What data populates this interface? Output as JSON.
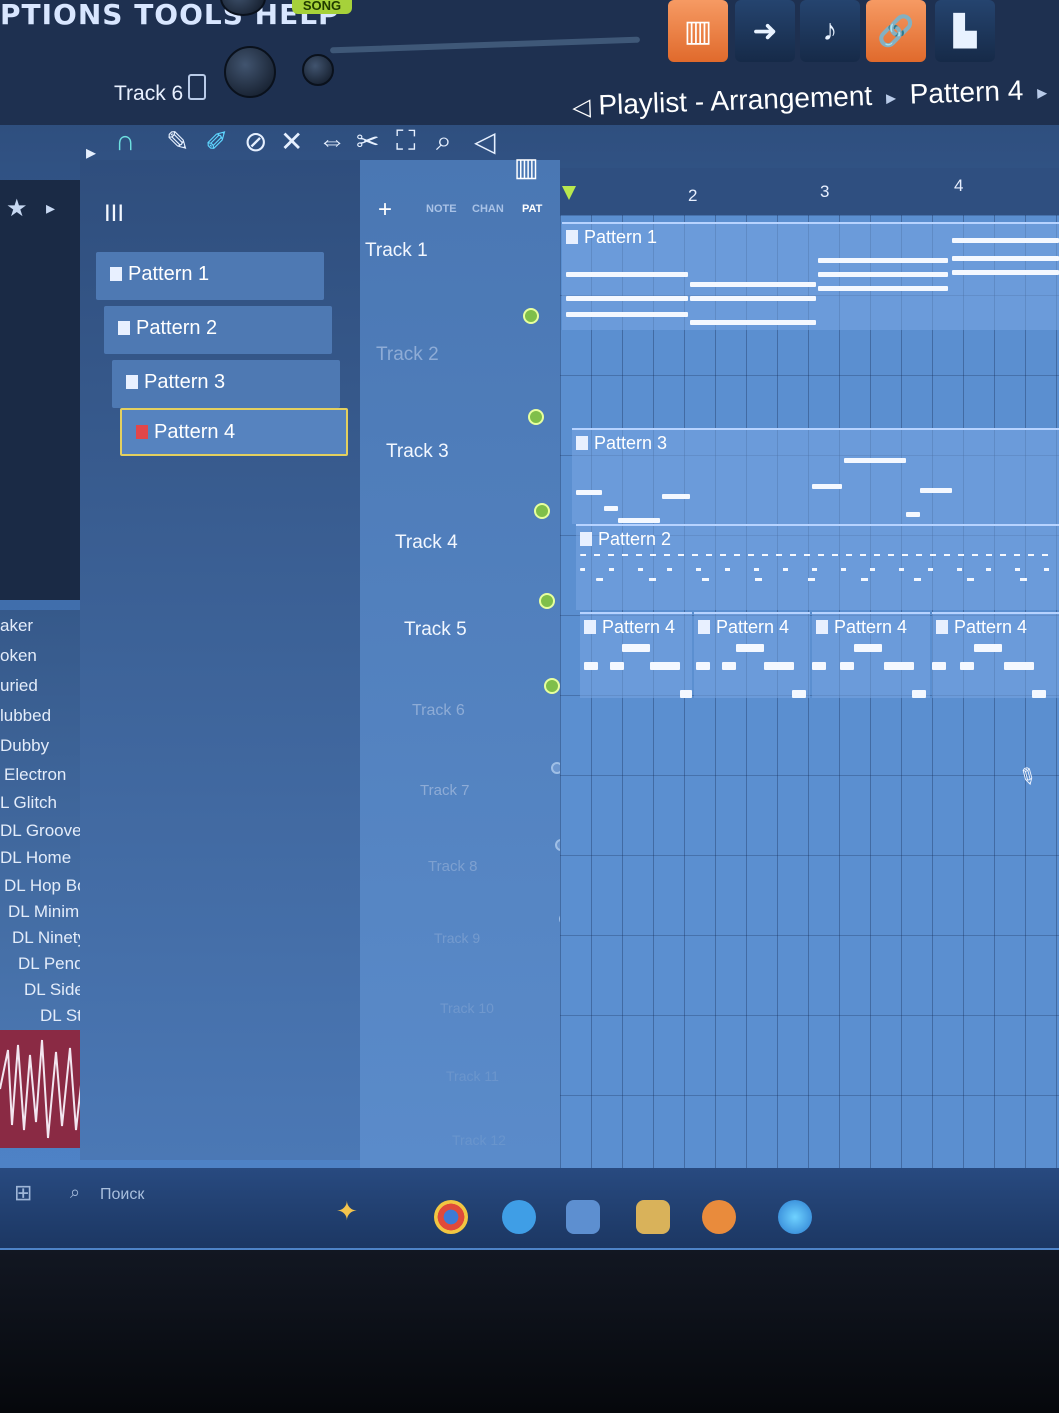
{
  "menu": {
    "options_tools_help": "PTIONS TOOLS HELP",
    "song_mode": "SONG"
  },
  "channel": {
    "track_label": "Track 6"
  },
  "window": {
    "title": "Playlist - Arrangement",
    "current_pattern": "Pattern 4"
  },
  "toolbar_icons": [
    "play-arrow-icon",
    "magnet-icon",
    "pencil-icon",
    "paint-icon",
    "delete-icon",
    "mute-icon",
    "slip-icon",
    "select-icon",
    "zoom-icon",
    "playback-icon"
  ],
  "picker": {
    "tabs": [
      "III"
    ],
    "patterns": [
      "Pattern 1",
      "Pattern 2",
      "Pattern 3",
      "Pattern 4"
    ],
    "selected": "Pattern 4"
  },
  "track_header": {
    "add": "+",
    "note": "NOTE",
    "chan": "CHAN",
    "pat": "PAT"
  },
  "tracks": [
    "Track 1",
    "Track 2",
    "Track 3",
    "Track 4",
    "Track 5",
    "Track 6",
    "Track 7",
    "Track 8",
    "Track 9",
    "Track 10",
    "Track 11",
    "Track 12"
  ],
  "timeline": {
    "bars": [
      "2",
      "3",
      "4"
    ]
  },
  "clips": {
    "track1": "Pattern 1",
    "track3": "Pattern 3",
    "track4": "Pattern 2",
    "track5": [
      "Pattern 4",
      "Pattern 4",
      "Pattern 4",
      "Pattern 4"
    ]
  },
  "browser": {
    "items": [
      "aker",
      "oken",
      "uried",
      "lubbed",
      "Dubby",
      "Electron",
      "L Glitch",
      "DL Groover",
      "DL Home",
      "DL Hop Box",
      "DL Minimus",
      "DL Ninety",
      "DL Pendulus",
      "DL Sidestep",
      "DL Stadium"
    ],
    "search_placeholder": "Поиск"
  },
  "colors": {
    "accent_orange": "#e87a3e",
    "song_green": "#a6d13a",
    "grid_blue": "#5b8fd0",
    "selected_outline": "#e3d05f"
  }
}
